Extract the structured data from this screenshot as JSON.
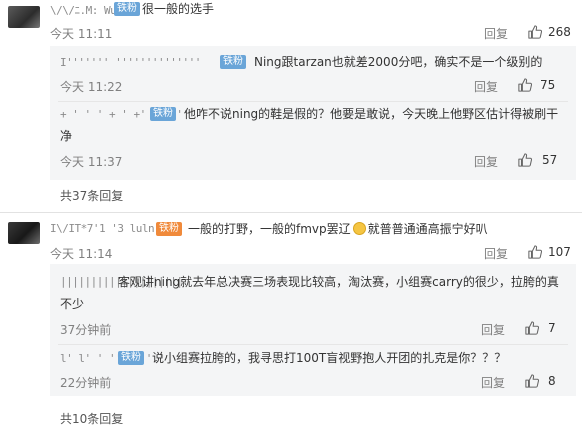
{
  "thread1": {
    "user": "\\/\\/ﾆ.M: Wu",
    "badge": "铁粉",
    "text": "很一般的选手",
    "time": "今天 11:11",
    "reply_label": "回复",
    "likes": "268",
    "replies": [
      {
        "user": "I''''''' ''''''''''''''",
        "badge": "铁粉",
        "text": "Ning跟tarzan也就差2000分吧，确实不是一个级别的",
        "time": "今天 11:22",
        "reply_label": "回复",
        "likes": "75"
      },
      {
        "user": "+ '  ' '  + ' +'  '  ' ''",
        "badge": "铁粉",
        "text_line1": "他咋不说ning的鞋是假的？他要是敢说，今天晚上他野区估计得被刷干",
        "text_line2": "净",
        "time": "今天 11:37",
        "reply_label": "回复",
        "likes": "57"
      }
    ],
    "more": "共37条回复"
  },
  "thread2": {
    "user": "I\\/IT*7'1 '3  luln",
    "badge": "铁粉",
    "text_before": "一般的打野，一般的fmvp罢辽",
    "text_after": "就普普通通高振宁好叭",
    "time": "今天 11:14",
    "reply_label": "回复",
    "likes": "107",
    "replies": [
      {
        "user": "||||||||||||||||||||",
        "text_line1": "客观讲ning就去年总决赛三场表现比较高，淘汰赛，小组赛carry的很少，拉胯的真",
        "text_line2": "不少",
        "time": "37分钟前",
        "reply_label": "回复",
        "likes": "7"
      },
      {
        "user": "l'  l'  '  ''' '  '  '",
        "badge": "铁粉",
        "text": "说小组赛拉胯的，我寻思打100T盲视野抱人开团的扎克是你？？？",
        "time": "22分钟前",
        "reply_label": "回复",
        "likes": "8"
      }
    ],
    "more": "共10条回复"
  }
}
